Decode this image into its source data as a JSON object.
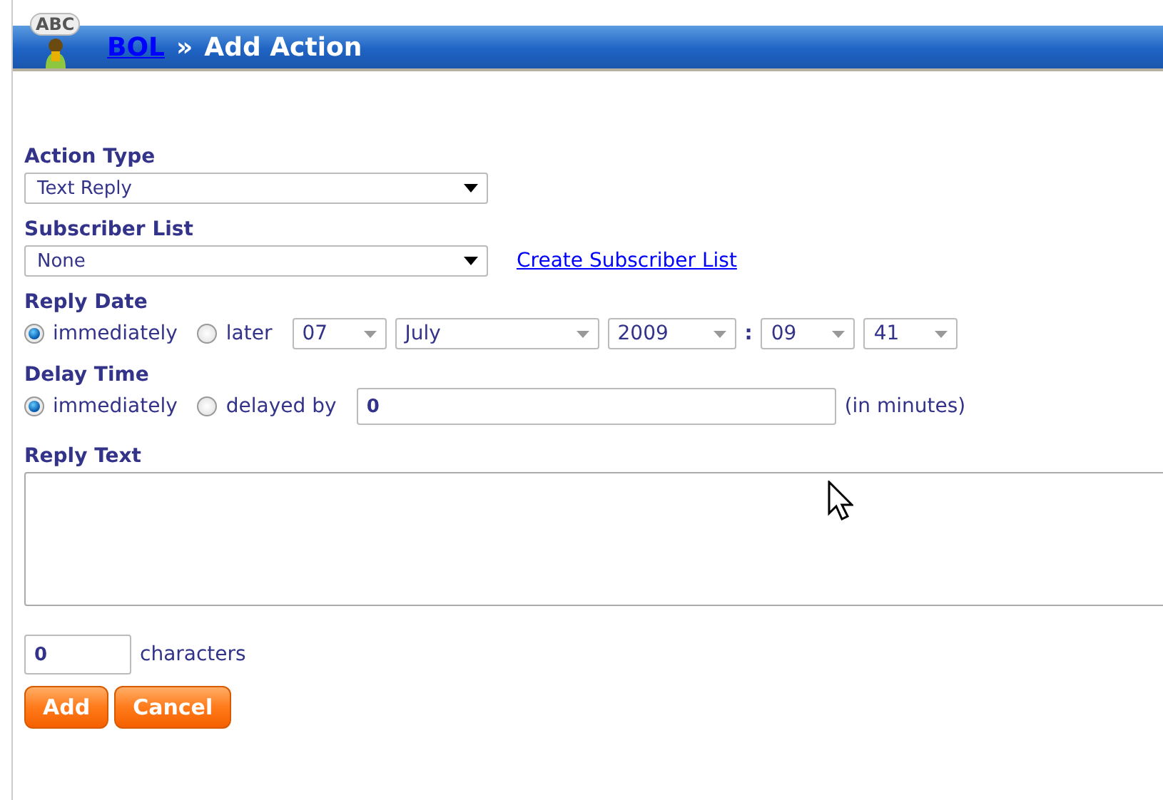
{
  "header": {
    "logo_text": "ABC",
    "breadcrumb_link": "BOL",
    "separator": "»",
    "title": "Add Action"
  },
  "action_type": {
    "label": "Action Type",
    "value": "Text Reply"
  },
  "subscriber_list": {
    "label": "Subscriber List",
    "value": "None",
    "link": "Create Subscriber List"
  },
  "reply_date": {
    "label": "Reply Date",
    "options": [
      {
        "label": "immediately",
        "selected": true
      },
      {
        "label": "later",
        "selected": false
      }
    ],
    "selects": [
      {
        "kind": "small",
        "value": "07"
      },
      {
        "kind": "wide",
        "value": "July"
      },
      {
        "kind": "medium",
        "value": "2009"
      },
      {
        "kind": "separator",
        "value": ":"
      },
      {
        "kind": "small",
        "value": "09"
      },
      {
        "kind": "small",
        "value": "41"
      }
    ]
  },
  "delay_time": {
    "label": "Delay Time",
    "options": [
      {
        "label": "immediately",
        "selected": true
      },
      {
        "label": "delayed by",
        "selected": false
      }
    ],
    "value": "0",
    "unit": "(in minutes)"
  },
  "reply_text": {
    "label": "Reply Text"
  },
  "counter": {
    "value": "0",
    "label": "characters"
  },
  "buttons": [
    {
      "label": "Add"
    },
    {
      "label": "Cancel"
    }
  ]
}
